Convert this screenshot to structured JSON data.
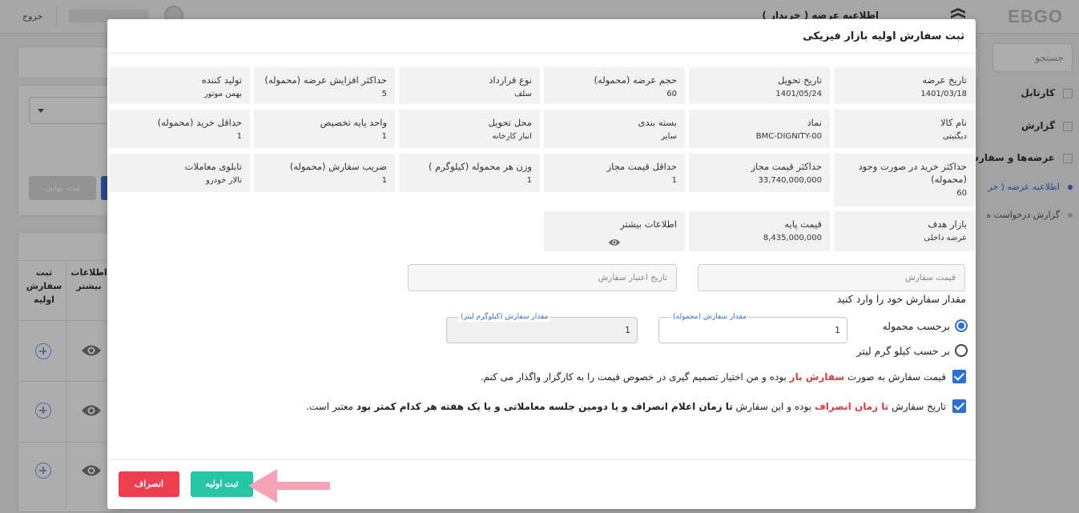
{
  "app": {
    "logo": "EBGO",
    "header_title": "اطلاعیه عرضه ( خریدار )",
    "logout": "خروج"
  },
  "sidebar": {
    "search_placeholder": "جستجو",
    "items": [
      {
        "label": "کارتابل"
      },
      {
        "label": "گزارش"
      },
      {
        "label": "عرضه‌ها و سفارش"
      }
    ],
    "subitems": [
      {
        "label": "اطلاعیه عرضه ( خر"
      },
      {
        "label": "گزارش درخواست ه"
      }
    ]
  },
  "background": {
    "final_button": "ثبت نهایی",
    "col_register": "ثبت سفارش اولیه",
    "col_more_info": "اطلاعات بیشتر"
  },
  "modal": {
    "title": "ثبت سفارش اولیه بازار فیزیکی",
    "info": {
      "row1": [
        {
          "label": "تاریخ عرضه",
          "value": "1401/03/18"
        },
        {
          "label": "تاریخ تحویل",
          "value": "1401/05/24"
        },
        {
          "label": "حجم عرضه (محموله)",
          "value": "60"
        },
        {
          "label": "نوع قرارداد",
          "value": "سلف"
        },
        {
          "label": "حداکثر افزایش عرضه (محموله)",
          "value": "5"
        },
        {
          "label": "تولید کننده",
          "value": "بهمن موتور"
        }
      ],
      "row2": [
        {
          "label": "نام کالا",
          "value": "دیگنیتی"
        },
        {
          "label": "نماد",
          "value": "BMC-DIGNITY-00"
        },
        {
          "label": "بسته بندی",
          "value": "سایر"
        },
        {
          "label": "محل تحویل",
          "value": "انبار کارخانه"
        },
        {
          "label": "واحد پایه تخصیص",
          "value": "1"
        },
        {
          "label": "حداقل خرید (محموله)",
          "value": "1"
        }
      ],
      "row3": [
        {
          "label": "حداکثر خرید در صورت وجود (محموله)",
          "value": "60"
        },
        {
          "label": "حداکثر قیمت مجاز",
          "value": "33,740,000,000"
        },
        {
          "label": "حداقل قیمت مجاز",
          "value": "1"
        },
        {
          "label": "وزن هر محموله (کیلوگرم )",
          "value": "1"
        },
        {
          "label": "ضریب سفارش (محموله)",
          "value": "1"
        },
        {
          "label": "تابلوی معاملات",
          "value": "تالار خودرو"
        }
      ],
      "row4": [
        {
          "label": "بازار هدف",
          "value": "عرضه داخلی"
        },
        {
          "label": "قیمت پایه",
          "value": "8,435,000,000"
        },
        {
          "label": "اطلاعات بیشتر",
          "icon": "eye-icon"
        }
      ]
    },
    "form": {
      "price_placeholder": "قیمت سفارش",
      "validity_placeholder": "تاریخ اعتبار سفارش",
      "enter_amount_title": "مقدار سفارش خود را وارد کنید",
      "radio_by_shipment": "برحسب محموله",
      "radio_by_kg": "بر حسب کیلو گرم لیتر",
      "qty_shipment_label": "مقدار سفارش (محموله)",
      "qty_shipment_value": "1",
      "qty_kg_label": "مقدار سفارش (کیلوگرم لیتر)",
      "qty_kg_value": "1",
      "check1": {
        "part1": "قیمت سفارش به صورت",
        "highlight": "سفارش باز",
        "part2": "بوده و من اختیار تصمیم گیری در خصوص قیمت را به کارگزار واگذار می کنم."
      },
      "check2": {
        "part1": "تاریخ سفارش",
        "highlight": "تا زمان انصراف",
        "part2": "بوده و این سفارش",
        "bold": "تا زمان اعلام انصراف و یا دومین جلسه معاملاتی و یا یک هفته هر کدام کمتر بود",
        "part3": "معتبر است."
      }
    },
    "buttons": {
      "submit": "ثبت اولیه",
      "cancel": "انصراف"
    }
  },
  "colors": {
    "submit": "#26c6a4",
    "cancel": "#ee3d4f",
    "accent": "#2b6fd8",
    "highlight": "#e2383f",
    "arrow": "#f0a0b0"
  }
}
